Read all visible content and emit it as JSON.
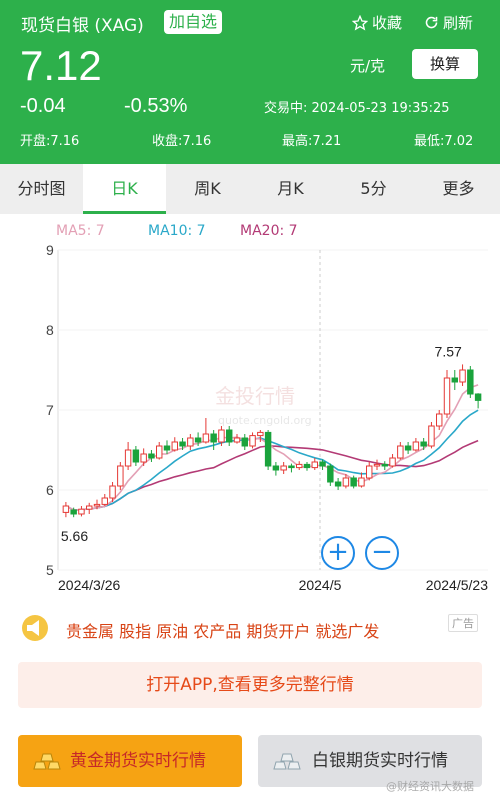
{
  "header": {
    "title": "现货白银 (XAG)",
    "add_watch": "加自选",
    "favorite": "收藏",
    "refresh": "刷新",
    "price": "7.12",
    "unit": "元/克",
    "switch": "换算",
    "change": "-0.04",
    "change_pct": "-0.53%",
    "trade_time": "交易中: 2024-05-23 19:35:25",
    "open": "开盘:7.16",
    "close": "收盘:7.16",
    "high": "最高:7.21",
    "low": "最低:7.02",
    "colors": {
      "bg": "#2db04b",
      "text": "#ffffff"
    }
  },
  "tabs": [
    "分时图",
    "日K",
    "周K",
    "月K",
    "5分",
    "更多"
  ],
  "active_tab": "日K",
  "ma": {
    "ma5": "MA5: 7",
    "ma10": "MA10: 7",
    "ma20": "MA20: 7"
  },
  "chart_data": {
    "type": "candlestick",
    "y_ticks": [
      "9",
      "8",
      "7",
      "6",
      "5"
    ],
    "ylim": [
      5,
      9
    ],
    "x_labels": [
      "2024/3/26",
      "2024/5",
      "2024/5/23"
    ],
    "max_label": "7.57",
    "min_label": "5.66",
    "watermark": "金投行情",
    "watermark_sub": "quote.cngold.org",
    "candles": [
      [
        5.72,
        5.8,
        5.66,
        5.85
      ],
      [
        5.75,
        5.7,
        5.66,
        5.78
      ],
      [
        5.7,
        5.76,
        5.67,
        5.8
      ],
      [
        5.76,
        5.8,
        5.7,
        5.84
      ],
      [
        5.8,
        5.82,
        5.76,
        5.88
      ],
      [
        5.82,
        5.9,
        5.8,
        5.95
      ],
      [
        5.9,
        6.05,
        5.85,
        6.1
      ],
      [
        6.05,
        6.3,
        6.0,
        6.35
      ],
      [
        6.3,
        6.5,
        6.25,
        6.6
      ],
      [
        6.5,
        6.35,
        6.3,
        6.55
      ],
      [
        6.35,
        6.45,
        6.3,
        6.52
      ],
      [
        6.45,
        6.4,
        6.35,
        6.5
      ],
      [
        6.4,
        6.55,
        6.38,
        6.6
      ],
      [
        6.55,
        6.5,
        6.45,
        6.62
      ],
      [
        6.5,
        6.6,
        6.48,
        6.66
      ],
      [
        6.6,
        6.55,
        6.5,
        6.65
      ],
      [
        6.55,
        6.65,
        6.5,
        6.7
      ],
      [
        6.65,
        6.6,
        6.55,
        6.72
      ],
      [
        6.6,
        6.7,
        6.58,
        6.9
      ],
      [
        6.7,
        6.6,
        6.5,
        6.75
      ],
      [
        6.6,
        6.75,
        6.55,
        6.8
      ],
      [
        6.75,
        6.6,
        6.55,
        6.8
      ],
      [
        6.6,
        6.65,
        6.58,
        6.7
      ],
      [
        6.65,
        6.55,
        6.5,
        6.7
      ],
      [
        6.55,
        6.68,
        6.52,
        6.72
      ],
      [
        6.68,
        6.72,
        6.6,
        6.75
      ],
      [
        6.72,
        6.3,
        6.25,
        6.75
      ],
      [
        6.3,
        6.25,
        6.18,
        6.35
      ],
      [
        6.25,
        6.3,
        6.2,
        6.35
      ],
      [
        6.3,
        6.28,
        6.22,
        6.33
      ],
      [
        6.28,
        6.32,
        6.25,
        6.36
      ],
      [
        6.32,
        6.28,
        6.24,
        6.35
      ],
      [
        6.28,
        6.35,
        6.25,
        6.4
      ],
      [
        6.35,
        6.3,
        6.25,
        6.38
      ],
      [
        6.3,
        6.1,
        6.05,
        6.33
      ],
      [
        6.1,
        6.05,
        6.0,
        6.15
      ],
      [
        6.05,
        6.15,
        6.02,
        6.2
      ],
      [
        6.15,
        6.05,
        6.02,
        6.18
      ],
      [
        6.05,
        6.15,
        6.03,
        6.22
      ],
      [
        6.15,
        6.3,
        6.12,
        6.35
      ],
      [
        6.3,
        6.32,
        6.25,
        6.38
      ],
      [
        6.32,
        6.3,
        6.25,
        6.36
      ],
      [
        6.3,
        6.4,
        6.28,
        6.45
      ],
      [
        6.4,
        6.55,
        6.38,
        6.6
      ],
      [
        6.55,
        6.5,
        6.45,
        6.6
      ],
      [
        6.5,
        6.6,
        6.48,
        6.65
      ],
      [
        6.6,
        6.55,
        6.5,
        6.65
      ],
      [
        6.55,
        6.8,
        6.52,
        6.85
      ],
      [
        6.8,
        6.95,
        6.75,
        7.0
      ],
      [
        6.95,
        7.4,
        6.9,
        7.5
      ],
      [
        7.4,
        7.35,
        7.25,
        7.5
      ],
      [
        7.35,
        7.5,
        7.3,
        7.57
      ],
      [
        7.5,
        7.2,
        7.15,
        7.55
      ],
      [
        7.2,
        7.12,
        7.02,
        7.21
      ]
    ]
  },
  "ad": {
    "text": "贵金属 股指 原油 农产品 期货开户 就选广发",
    "tag": "广告",
    "open_app": "打开APP,查看更多完整行情",
    "btn_gold": "黄金期货实时行情",
    "btn_silver": "白银期货实时行情"
  },
  "watermark": "@财经资讯大数据"
}
